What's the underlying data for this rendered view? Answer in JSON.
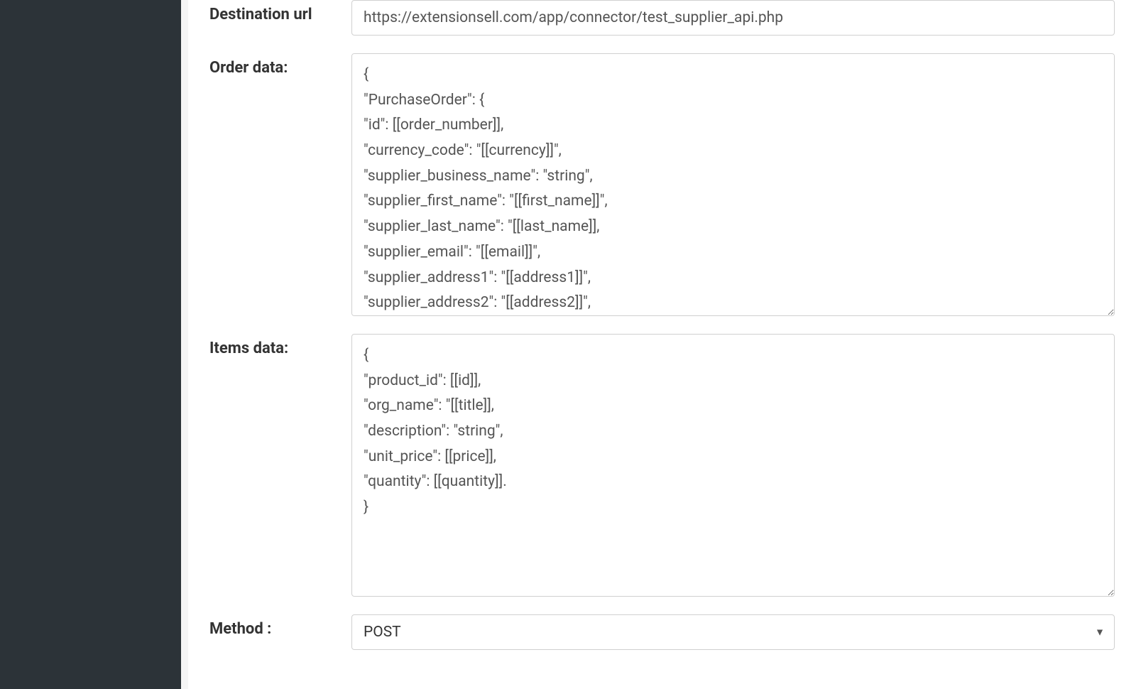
{
  "labels": {
    "destination_url": "Destination url",
    "order_data": "Order data:",
    "items_data": "Items data:",
    "method": "Method :"
  },
  "fields": {
    "destination_url_value": "https://extensionsell.com/app/connector/test_supplier_api.php",
    "order_data_value": "{\n\"PurchaseOrder\": {\n\"id\": [[order_number]],\n\"currency_code\": \"[[currency]]\",\n\"supplier_business_name\": \"string\",\n\"supplier_first_name\": \"[[first_name]]\",\n\"supplier_last_name\": \"[[last_name]],\n\"supplier_email\": \"[[email]]\",\n\"supplier_address1\": \"[[address1]]\",\n\"supplier_address2\": \"[[address2]]\",",
    "items_data_value": "{\n\"product_id\": [[id]],\n\"org_name\": \"[[title]],\n\"description\": \"string\",\n\"unit_price\": [[price]],\n\"quantity\": [[quantity]].\n}",
    "method_value": "POST"
  }
}
